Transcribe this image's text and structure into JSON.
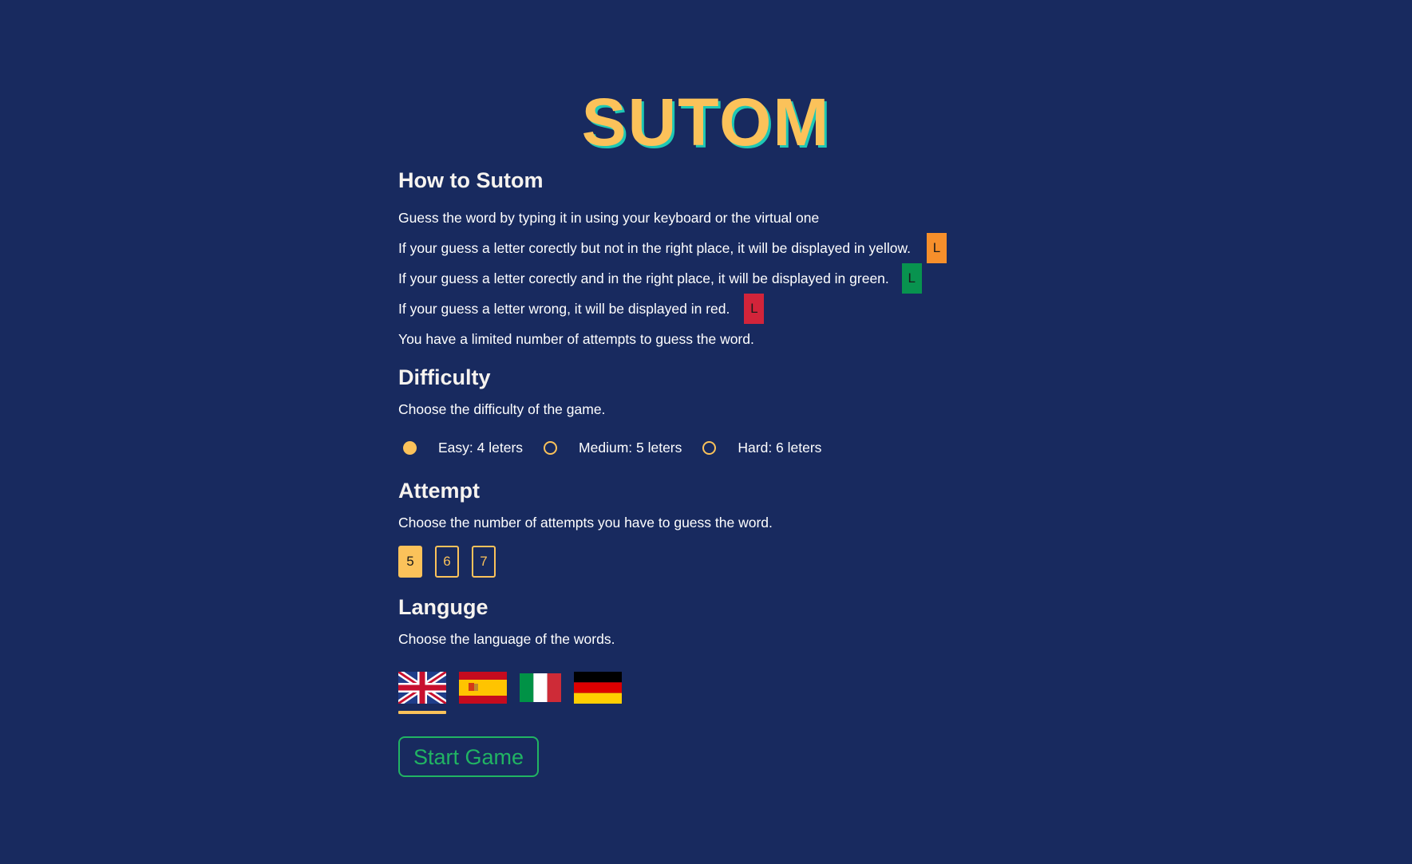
{
  "title": "SUTOM",
  "how_to": {
    "heading": "How to Sutom",
    "line1": "Guess the word by typing it in using your keyboard or the virtual one",
    "line2": "If your guess a letter corectly but not in the right place, it will be displayed in yellow.",
    "line3": "If your guess a letter corectly and in the right place, it will be displayed in green.",
    "line4": "If your guess a letter wrong, it will be displayed in red.",
    "line5": "You have a limited number of attempts to guess the word.",
    "example_letter": "L",
    "colors": {
      "yellow": "#f68f2b",
      "green": "#08934f",
      "red": "#d2243a"
    }
  },
  "difficulty": {
    "heading": "Difficulty",
    "description": "Choose the difficulty of the game.",
    "options": [
      {
        "label": "Easy: 4 leters",
        "checked": true
      },
      {
        "label": "Medium: 5 leters",
        "checked": false
      },
      {
        "label": "Hard: 6 leters",
        "checked": false
      }
    ]
  },
  "attempt": {
    "heading": "Attempt",
    "description": "Choose the number of attempts you have to guess the word.",
    "options": [
      {
        "label": "5",
        "selected": true
      },
      {
        "label": "6",
        "selected": false
      },
      {
        "label": "7",
        "selected": false
      }
    ]
  },
  "language": {
    "heading": "Languge",
    "description": "Choose the language of the words.",
    "flags": [
      {
        "icon": "uk-flag-icon",
        "selected": true
      },
      {
        "icon": "spain-flag-icon",
        "selected": false
      },
      {
        "icon": "italy-flag-icon",
        "selected": false
      },
      {
        "icon": "germany-flag-icon",
        "selected": false
      }
    ]
  },
  "start_button": "Start Game",
  "theme": {
    "background": "#182a5f",
    "accent": "#fbc25a",
    "button_green": "#21b463"
  }
}
